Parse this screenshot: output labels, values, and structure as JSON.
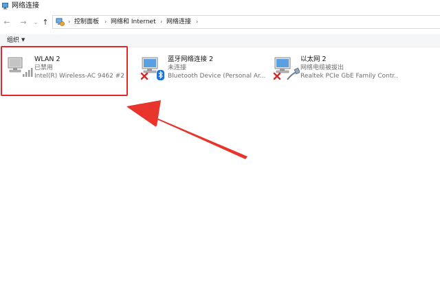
{
  "window": {
    "title": "网络连接",
    "title_icon": "network-connections-icon"
  },
  "nav": {
    "back_icon": "arrow-left-icon",
    "forward_icon": "arrow-right-icon",
    "up_icon": "arrow-up-icon"
  },
  "address": {
    "location_icon": "control-panel-icon",
    "crumbs": [
      "控制面板",
      "网络和 Internet",
      "网络连接"
    ]
  },
  "toolbar": {
    "organize_label": "组织"
  },
  "adapters": [
    {
      "name": "WLAN 2",
      "status": "已禁用",
      "device": "Intel(R) Wireless-AC 9462 #2",
      "icon": "wifi-adapter-icon"
    },
    {
      "name": "蓝牙网络连接 2",
      "status": "未连接",
      "device": "Bluetooth Device (Personal Ar...",
      "icon": "bluetooth-adapter-icon"
    },
    {
      "name": "以太网 2",
      "status": "网络电缆被拔出",
      "device": "Realtek PCIe GbE Family Contr...",
      "icon": "ethernet-adapter-icon"
    }
  ],
  "colors": {
    "highlight": "#e4262a",
    "secondary_text": "#6d6d6d"
  }
}
